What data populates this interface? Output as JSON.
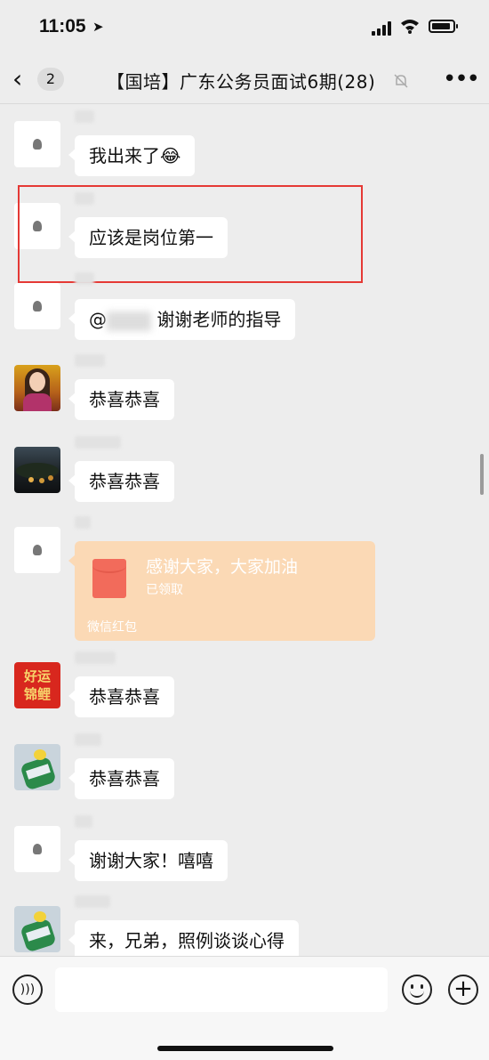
{
  "status_bar": {
    "time": "11:05"
  },
  "nav": {
    "unread": "2",
    "title": "【国培】广东公务员面试6期(28)"
  },
  "messages": [
    {
      "text": "我出来了😂"
    },
    {
      "text": "应该是岗位第一"
    },
    {
      "prefix": "@",
      "suffix": "谢谢老师的指导"
    },
    {
      "text": "恭喜恭喜"
    },
    {
      "text": "恭喜恭喜"
    },
    {
      "red_packet": {
        "title": "感谢大家，大家加油",
        "status": "已领取",
        "footer": "微信红包"
      }
    },
    {
      "text": "恭喜恭喜"
    },
    {
      "text": "恭喜恭喜"
    },
    {
      "text": "谢谢大家！嘻嘻"
    },
    {
      "text": "来，兄弟，照例谈谈心得"
    }
  ],
  "avatars": {
    "red_text": "好运锦鲤"
  },
  "colors": {
    "background": "#ededed",
    "highlight": "#e53935",
    "red_packet": "#fbd9b5"
  }
}
